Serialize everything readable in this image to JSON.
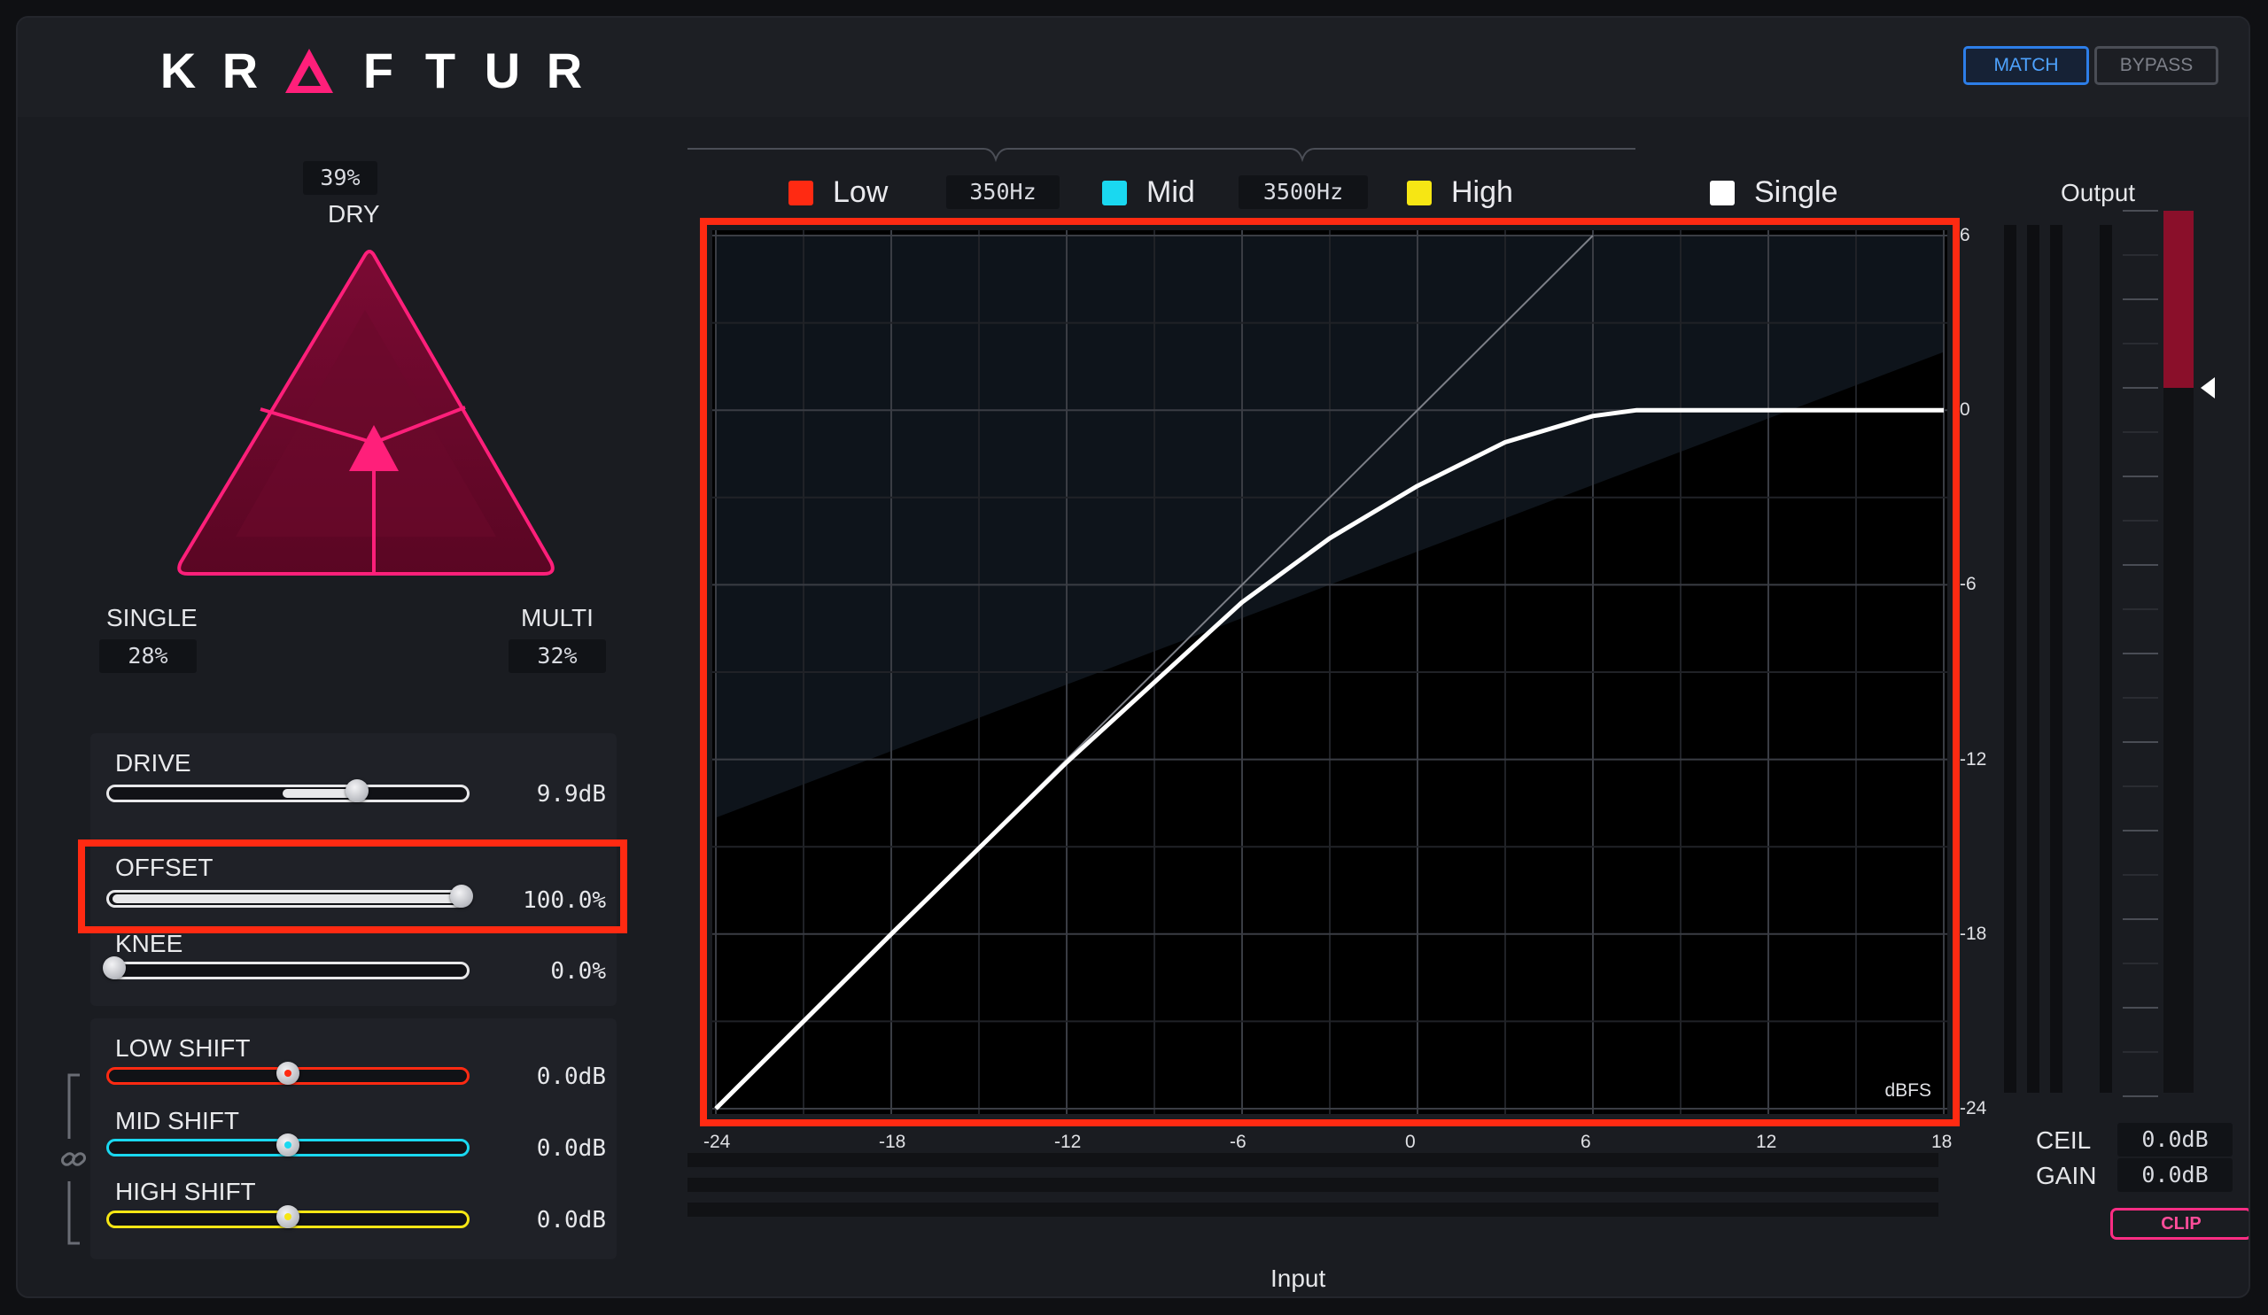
{
  "header": {
    "logo_letters": [
      "K",
      "R",
      "A",
      "F",
      "T",
      "U",
      "R"
    ],
    "match_label": "MATCH",
    "bypass_label": "BYPASS"
  },
  "mix": {
    "dry_value": "39%",
    "dry_label": "DRY",
    "single_label": "SINGLE",
    "single_value": "28%",
    "multi_label": "MULTI",
    "multi_value": "32%"
  },
  "controls": {
    "drive": {
      "label": "DRIVE",
      "value": "9.9dB",
      "position": 0.7
    },
    "offset": {
      "label": "OFFSET",
      "value": "100.0%",
      "position": 1.0
    },
    "knee": {
      "label": "KNEE",
      "value": "0.0%",
      "position": 0.0
    }
  },
  "shifts": {
    "low": {
      "label": "LOW SHIFT",
      "value": "0.0dB",
      "position": 0.5,
      "color": "#ff2a12"
    },
    "mid": {
      "label": "MID SHIFT",
      "value": "0.0dB",
      "position": 0.5,
      "color": "#1ad8f0"
    },
    "high": {
      "label": "HIGH SHIFT",
      "value": "0.0dB",
      "position": 0.5,
      "color": "#f6e614"
    }
  },
  "bands": {
    "low_label": "Low",
    "low_color": "#ff2a12",
    "crossover_1": "350Hz",
    "mid_label": "Mid",
    "mid_color": "#1ad8f0",
    "crossover_2": "3500Hz",
    "high_label": "High",
    "high_color": "#f6e614",
    "single_label": "Single",
    "single_color": "#ffffff"
  },
  "graph": {
    "unit_label": "dBFS",
    "x_axis_label": "Input",
    "x_ticks": [
      "-24",
      "-18",
      "-12",
      "-6",
      "0",
      "6",
      "12",
      "18"
    ],
    "y_ticks": [
      "6",
      "0",
      "-6",
      "-12",
      "-18",
      "-24"
    ]
  },
  "chart_data": {
    "type": "line",
    "xlabel": "Input",
    "xlim": [
      -24,
      18
    ],
    "ylim": [
      -24,
      6
    ],
    "series": [
      {
        "x": [
          -24,
          -18,
          -12,
          -6,
          -3,
          0,
          3,
          6,
          7.5,
          12,
          18
        ],
        "y": [
          -24,
          -18,
          -12.1,
          -6.6,
          -4.4,
          -2.6,
          -1.1,
          -0.2,
          0,
          0,
          0
        ]
      }
    ]
  },
  "output": {
    "title": "Output",
    "ceil_label": "CEIL",
    "ceil_value": "0.0dB",
    "gain_label": "GAIN",
    "gain_value": "0.0dB",
    "clip_label": "CLIP",
    "ceiling_db": 0
  }
}
